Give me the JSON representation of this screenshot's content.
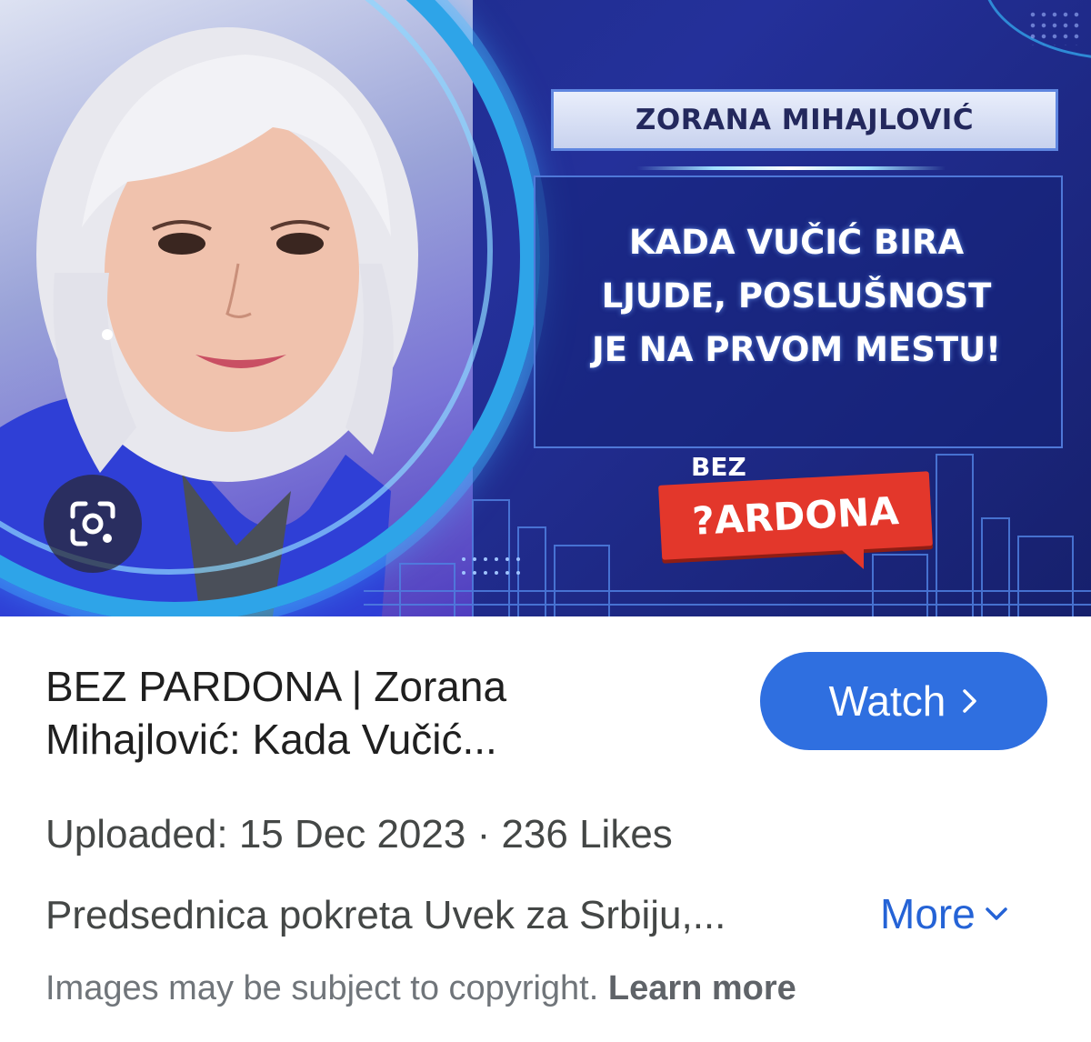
{
  "thumbnail": {
    "name_banner": "ZORANA MIHAJLOVIĆ",
    "quote_lines": [
      "KADA VUČIĆ BIRA",
      "LJUDE, POSLUŠNOST",
      "JE NA PRVOM MESTU!"
    ],
    "logo_top": "BEZ",
    "logo_main": "?ARDONA",
    "lens_icon": "google-lens-icon"
  },
  "result": {
    "title_line1": "BEZ PARDONA | Zorana",
    "title_line2": "Mihajlović: Kada Vučić...",
    "watch_label": "Watch",
    "meta": "Uploaded: 15 Dec 2023 · 236 Likes",
    "description": "Predsednica pokreta Uvek za Srbiju,...",
    "more_label": "More"
  },
  "footer": {
    "copyright_text": "Images may be subject to copyright.",
    "learn_more": "Learn more"
  },
  "colors": {
    "accent": "#2f6fe0",
    "thumbnail_bg": "#24309a",
    "logo_red": "#e3372b"
  }
}
